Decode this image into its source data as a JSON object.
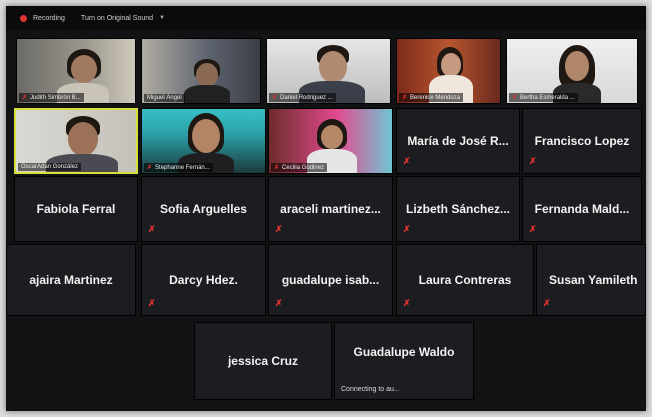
{
  "topbar": {
    "recording_label": "Recording",
    "sound_label": "Turn on Original Sound"
  },
  "participants": [
    {
      "name": "Judith Simbrón B...",
      "video": true
    },
    {
      "name": "Miguel Ángel",
      "video": true
    },
    {
      "name": "Daniel Rodriguez ...",
      "video": true
    },
    {
      "name": "Berenice Mendoza",
      "video": true
    },
    {
      "name": "Bertha Esmeralda ...",
      "video": true
    },
    {
      "name": "OscarAdán González",
      "video": true,
      "active": true
    },
    {
      "name": "Stephanne Fernán...",
      "video": true
    },
    {
      "name": "Cecilia Godinez",
      "video": true
    },
    {
      "name": "María de José R...",
      "video": false
    },
    {
      "name": "Francisco Lopez",
      "video": false
    },
    {
      "name": "Fabiola Ferral",
      "video": false
    },
    {
      "name": "Sofia Arguelles",
      "video": false
    },
    {
      "name": "araceli martinez...",
      "video": false
    },
    {
      "name": "Lizbeth Sánchez...",
      "video": false
    },
    {
      "name": "Fernanda Mald...",
      "video": false
    },
    {
      "name": "ajaira Martinez",
      "video": false
    },
    {
      "name": "Darcy Hdez.",
      "video": false
    },
    {
      "name": "guadalupe isab...",
      "video": false
    },
    {
      "name": "Laura Contreras",
      "video": false
    },
    {
      "name": "Susan Yamileth",
      "video": false
    },
    {
      "name": "jessica Cruz",
      "video": false
    },
    {
      "name": "Guadalupe Waldo",
      "video": false,
      "status": "Connecting to au..."
    }
  ],
  "colors": {
    "accent_active": "#d7df3a",
    "muted_red": "#e03030",
    "background": "#111214"
  }
}
